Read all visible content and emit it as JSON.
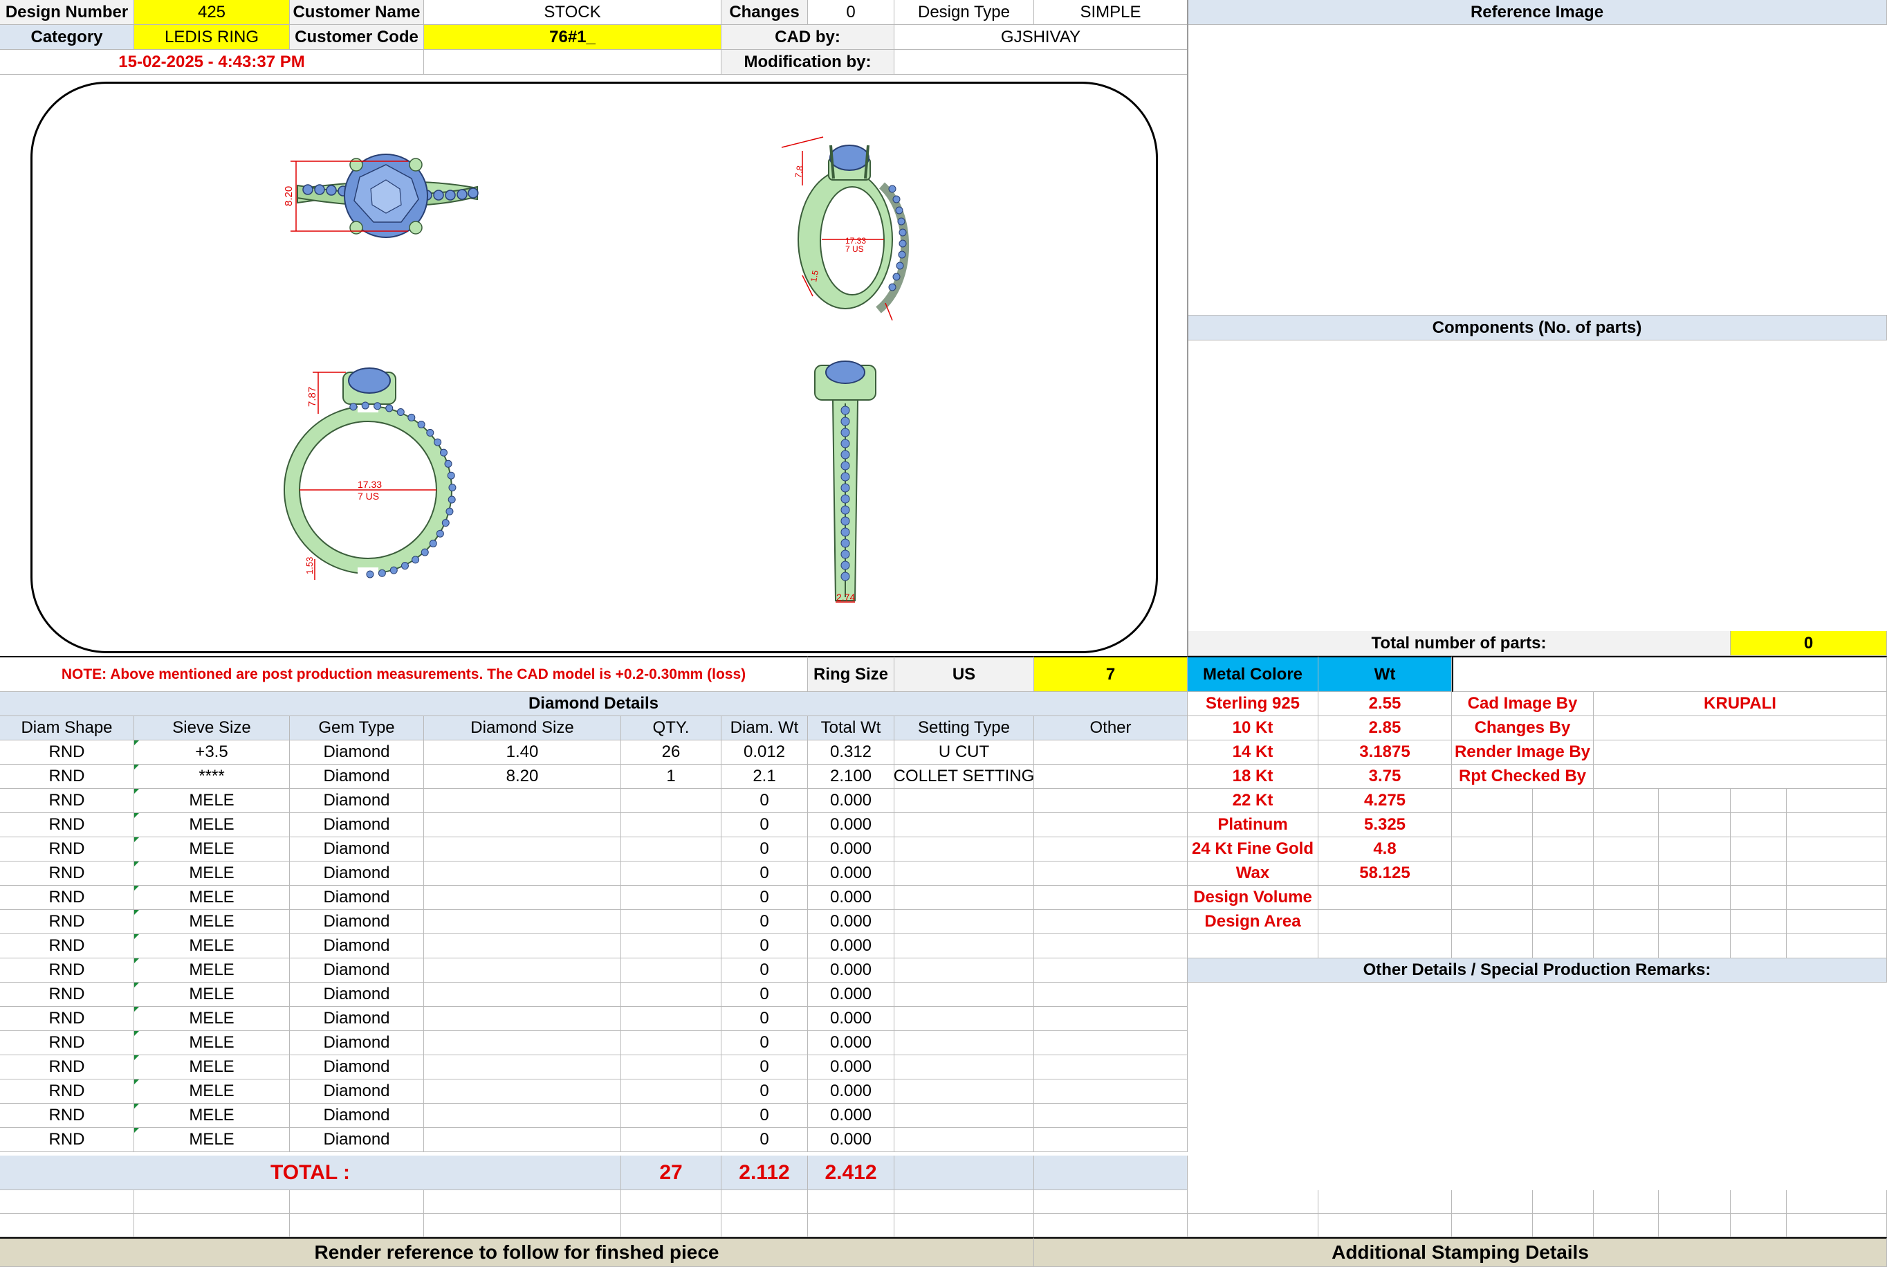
{
  "header": {
    "design_number_label": "Design Number",
    "design_number": "425",
    "customer_name_label": "Customer Name",
    "customer_name": "STOCK",
    "changes_label": "Changes",
    "changes": "0",
    "design_type_label": "Design Type",
    "design_type": "SIMPLE",
    "category_label": "Category",
    "category": "LEDIS RING",
    "customer_code_label": "Customer Code",
    "customer_code": "76#1_",
    "cad_by_label": "CAD by:",
    "cad_by": "GJSHIVAY",
    "date": "15-02-2025 - 4:43:37 PM",
    "modification_by_label": "Modification by:",
    "modification_by": ""
  },
  "reference_image_title": "Reference Image",
  "components_title": "Components (No. of parts)",
  "total_parts_label": "Total number of parts:",
  "total_parts": "0",
  "drawing": {
    "dims": {
      "top_width": "8.20",
      "side_height": "7.8",
      "side_inner": "17.33",
      "side_us": "7 US",
      "side_bottom": "1.5",
      "front_height": "7.87",
      "front_inner": "17.33",
      "front_us": "7 US",
      "front_bottom": "1.53",
      "profile_bottom": "2.74"
    }
  },
  "note": "NOTE: Above mentioned are post production measurements. The CAD model is +0.2-0.30mm (loss)",
  "ring_size_label": "Ring Size",
  "ring_size_unit": "US",
  "ring_size": "7",
  "metal": {
    "colore_label": "Metal Colore",
    "wt_label": "Wt",
    "rows": [
      {
        "name": "Sterling 925",
        "wt": "2.55"
      },
      {
        "name": "10 Kt",
        "wt": "2.85"
      },
      {
        "name": "14 Kt",
        "wt": "3.1875"
      },
      {
        "name": "18 Kt",
        "wt": "3.75"
      },
      {
        "name": "22 Kt",
        "wt": "4.275"
      },
      {
        "name": "Platinum",
        "wt": "5.325"
      },
      {
        "name": "24 Kt Fine Gold",
        "wt": "4.8"
      },
      {
        "name": "Wax",
        "wt": "58.125"
      },
      {
        "name": "Design Volume",
        "wt": ""
      },
      {
        "name": "Design Area",
        "wt": ""
      }
    ]
  },
  "credits": [
    {
      "label": "Cad Image By",
      "value": "KRUPALI"
    },
    {
      "label": "Changes By",
      "value": ""
    },
    {
      "label": "Render Image By",
      "value": ""
    },
    {
      "label": "Rpt Checked By",
      "value": ""
    }
  ],
  "diamond_details_title": "Diamond Details",
  "diamond_headers": [
    "Diam Shape",
    "Sieve Size",
    "Gem Type",
    "Diamond Size",
    "QTY.",
    "Diam. Wt",
    "Total Wt",
    "Setting Type",
    "Other"
  ],
  "diamond_rows": [
    [
      "RND",
      "+3.5",
      "Diamond",
      "1.40",
      "26",
      "0.012",
      "0.312",
      "U CUT",
      ""
    ],
    [
      "RND",
      "****",
      "Diamond",
      "8.20",
      "1",
      "2.1",
      "2.100",
      "COLLET SETTING",
      ""
    ],
    [
      "RND",
      "MELE",
      "Diamond",
      "",
      "",
      "0",
      "0.000",
      "",
      ""
    ],
    [
      "RND",
      "MELE",
      "Diamond",
      "",
      "",
      "0",
      "0.000",
      "",
      ""
    ],
    [
      "RND",
      "MELE",
      "Diamond",
      "",
      "",
      "0",
      "0.000",
      "",
      ""
    ],
    [
      "RND",
      "MELE",
      "Diamond",
      "",
      "",
      "0",
      "0.000",
      "",
      ""
    ],
    [
      "RND",
      "MELE",
      "Diamond",
      "",
      "",
      "0",
      "0.000",
      "",
      ""
    ],
    [
      "RND",
      "MELE",
      "Diamond",
      "",
      "",
      "0",
      "0.000",
      "",
      ""
    ],
    [
      "RND",
      "MELE",
      "Diamond",
      "",
      "",
      "0",
      "0.000",
      "",
      ""
    ],
    [
      "RND",
      "MELE",
      "Diamond",
      "",
      "",
      "0",
      "0.000",
      "",
      ""
    ],
    [
      "RND",
      "MELE",
      "Diamond",
      "",
      "",
      "0",
      "0.000",
      "",
      ""
    ],
    [
      "RND",
      "MELE",
      "Diamond",
      "",
      "",
      "0",
      "0.000",
      "",
      ""
    ],
    [
      "RND",
      "MELE",
      "Diamond",
      "",
      "",
      "0",
      "0.000",
      "",
      ""
    ],
    [
      "RND",
      "MELE",
      "Diamond",
      "",
      "",
      "0",
      "0.000",
      "",
      ""
    ],
    [
      "RND",
      "MELE",
      "Diamond",
      "",
      "",
      "0",
      "0.000",
      "",
      ""
    ],
    [
      "RND",
      "MELE",
      "Diamond",
      "",
      "",
      "0",
      "0.000",
      "",
      ""
    ],
    [
      "RND",
      "MELE",
      "Diamond",
      "",
      "",
      "0",
      "0.000",
      "",
      ""
    ]
  ],
  "total": {
    "label": "TOTAL :",
    "qty": "27",
    "diam_wt": "2.112",
    "total_wt": "2.412"
  },
  "other_details_title": "Other Details / Special Production Remarks:",
  "render_reference": "Render reference to follow for finshed piece",
  "stamping_details": "Additional Stamping Details",
  "colors": {
    "yellow": "#ffff00",
    "header_blue": "#dbe5f1",
    "cyan": "#00b0f0",
    "red_text": "#e00000",
    "tan": "#ddd9c4",
    "metal_green": "#b9e3b0",
    "stone_blue": "#6e94d8"
  }
}
